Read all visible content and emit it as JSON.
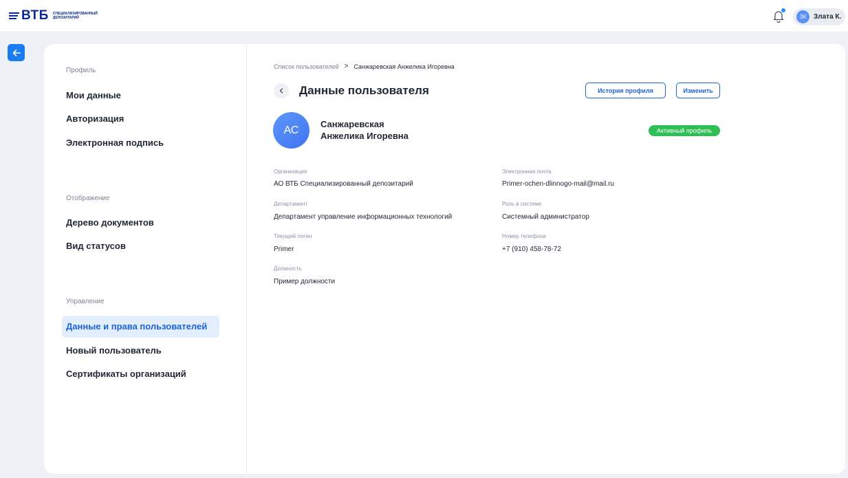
{
  "header": {
    "logo_text": "ВТБ",
    "logo_subtitle": "Специализированный депозитарий",
    "user_initials": "ЗК",
    "user_name": "Злата К."
  },
  "sidebar": {
    "sections": [
      {
        "label": "Профиль",
        "items": [
          "Мои данные",
          "Авторизация",
          "Электронная подпись"
        ]
      },
      {
        "label": "Отображение",
        "items": [
          "Дерево документов",
          "Вид статусов"
        ]
      },
      {
        "label": "Управление",
        "items": [
          "Данные и права пользователей",
          "Новый пользователь",
          "Сертификаты организаций"
        ]
      }
    ],
    "active_item": "Данные и права пользователей"
  },
  "breadcrumb": {
    "parent": "Список пользователей",
    "separator": ">",
    "current": "Санжаревская Анжелика Игоревна"
  },
  "page": {
    "title": "Данные пользователя",
    "history_button": "История профиля",
    "edit_button": "Изменить"
  },
  "user": {
    "initials": "АС",
    "last_name": "Санжаревская",
    "first_middle_name": "Анжелика Игоревна",
    "status": "Активный профиль"
  },
  "fields": {
    "organization": {
      "label": "Организация",
      "value": "АО ВТБ Специализированный депозитарий"
    },
    "email": {
      "label": "Электронная почта",
      "value": "Primer-ochen-dlinnogo-mail@mail.ru"
    },
    "department": {
      "label": "Департамент",
      "value": "Департамент управление информационных технологий"
    },
    "role": {
      "label": "Роль в системе",
      "value": "Системный администратор"
    },
    "login": {
      "label": "Текущий логин",
      "value": "Primer"
    },
    "phone": {
      "label": "Номер телефона",
      "value": "+7 (910) 458-78-72"
    },
    "position": {
      "label": "Должность",
      "value": "Пример должности"
    }
  },
  "colors": {
    "accent": "#1b64d8",
    "active_badge": "#2fbf56",
    "brand": "#0a2896"
  }
}
